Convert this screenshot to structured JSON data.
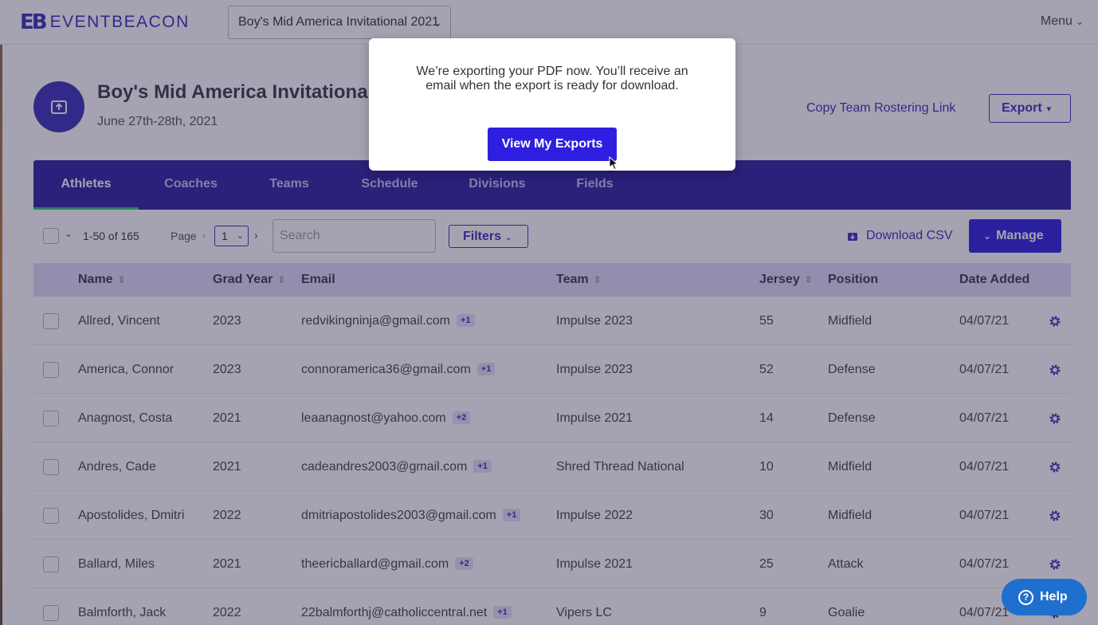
{
  "brand": {
    "mark": "EB",
    "name": "EVENTBEACON"
  },
  "topbar": {
    "event_select": "Boy's Mid America Invitational 2021",
    "menu_label": "Menu"
  },
  "header": {
    "event_title": "Boy's Mid America Invitational",
    "event_dates": "June 27th-28th, 2021",
    "copy_link": "Copy Team Rostering Link",
    "export_label": "Export"
  },
  "tabs": [
    "Athletes",
    "Coaches",
    "Teams",
    "Schedule",
    "Divisions",
    "Fields"
  ],
  "toolbar": {
    "range": "1-50 of 165",
    "page_label": "Page",
    "page_value": "1",
    "search_placeholder": "Search",
    "filters_label": "Filters",
    "download_csv": "Download CSV",
    "manage_label": "Manage"
  },
  "columns": [
    "Name",
    "Grad Year",
    "Email",
    "Team",
    "Jersey",
    "Position",
    "Date Added"
  ],
  "rows": [
    {
      "name": "Allred, Vincent",
      "grad_year": "2023",
      "email": "redvikingninja@gmail.com",
      "badge": "+1",
      "team": "Impulse 2023",
      "jersey": "55",
      "position": "Midfield",
      "date_added": "04/07/21"
    },
    {
      "name": "America, Connor",
      "grad_year": "2023",
      "email": "connoramerica36@gmail.com",
      "badge": "+1",
      "team": "Impulse 2023",
      "jersey": "52",
      "position": "Defense",
      "date_added": "04/07/21"
    },
    {
      "name": "Anagnost, Costa",
      "grad_year": "2021",
      "email": "leaanagnost@yahoo.com",
      "badge": "+2",
      "team": "Impulse 2021",
      "jersey": "14",
      "position": "Defense",
      "date_added": "04/07/21"
    },
    {
      "name": "Andres, Cade",
      "grad_year": "2021",
      "email": "cadeandres2003@gmail.com",
      "badge": "+1",
      "team": "Shred Thread National",
      "jersey": "10",
      "position": "Midfield",
      "date_added": "04/07/21"
    },
    {
      "name": "Apostolides, Dmitri",
      "grad_year": "2022",
      "email": "dmitriapostolides2003@gmail.com",
      "badge": "+1",
      "team": "Impulse 2022",
      "jersey": "30",
      "position": "Midfield",
      "date_added": "04/07/21"
    },
    {
      "name": "Ballard, Miles",
      "grad_year": "2021",
      "email": "theericballard@gmail.com",
      "badge": "+2",
      "team": "Impulse 2021",
      "jersey": "25",
      "position": "Attack",
      "date_added": "04/07/21"
    },
    {
      "name": "Balmforth, Jack",
      "grad_year": "2022",
      "email": "22balmforthj@catholiccentral.net",
      "badge": "+1",
      "team": "Vipers LC",
      "jersey": "9",
      "position": "Goalie",
      "date_added": "04/07/21"
    }
  ],
  "modal": {
    "message": "We’re exporting your PDF now. You’ll receive an email when the export is ready for download.",
    "button_label": "View My Exports"
  },
  "help": {
    "label": "Help"
  },
  "colors": {
    "brand": "#3a2fb8",
    "primary_button": "#2e1fe0",
    "tab_bar": "#2b1fa0",
    "active_tab_underline": "#2fc37a",
    "help_button": "#1f6fce"
  }
}
